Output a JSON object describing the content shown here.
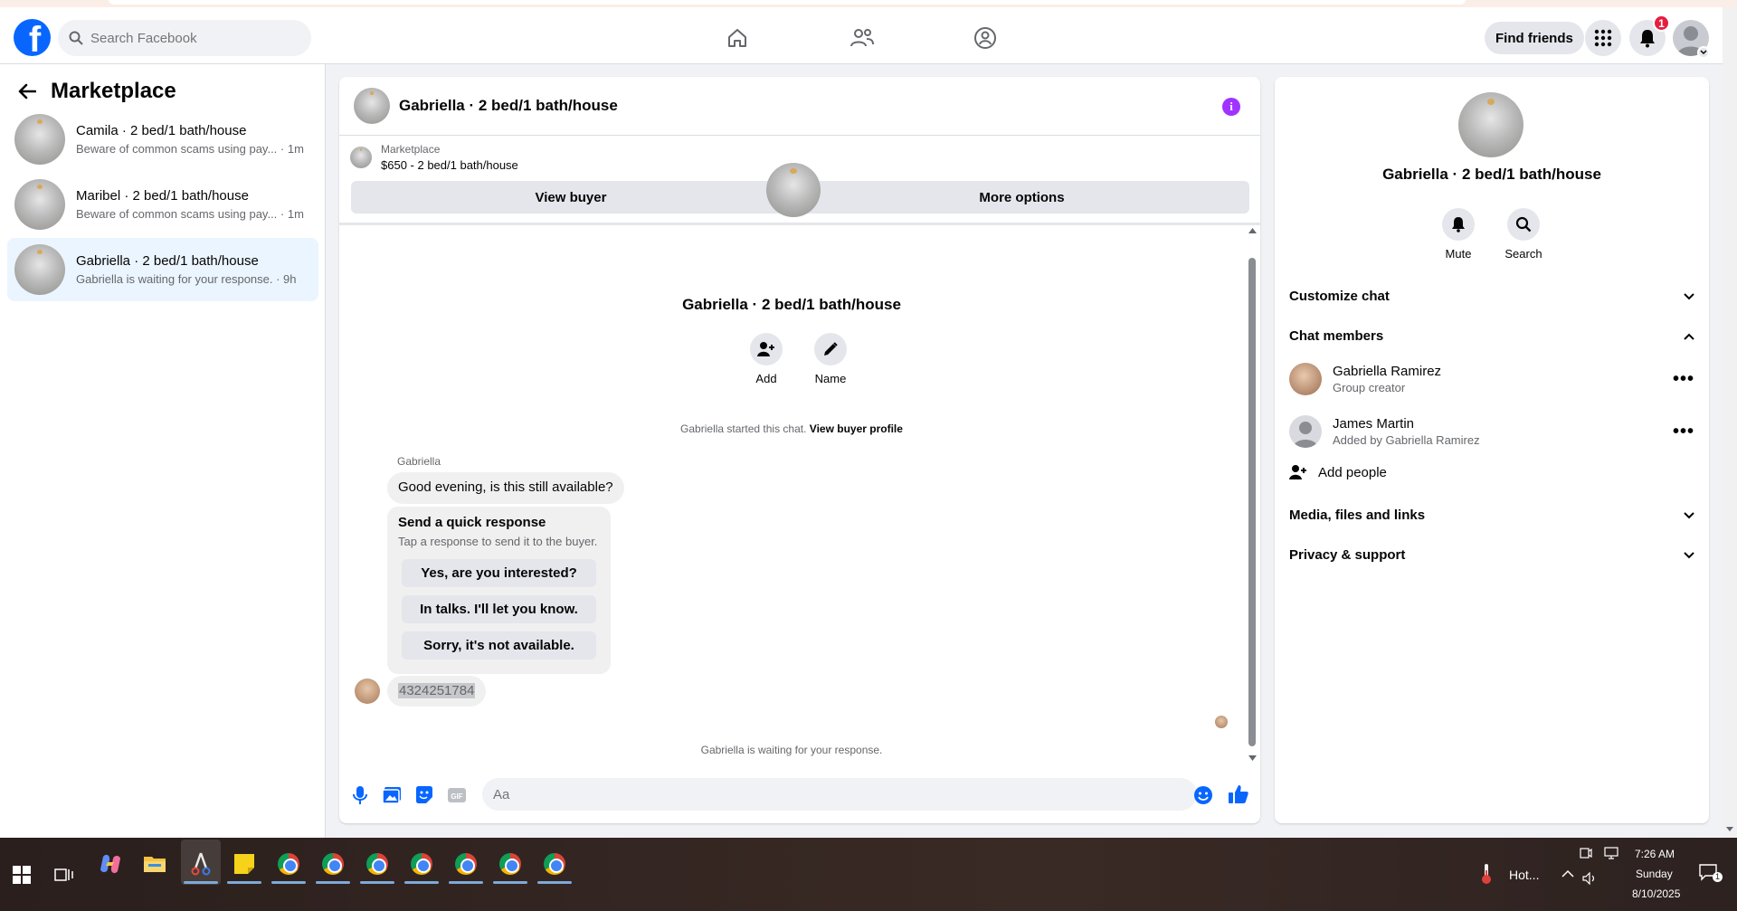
{
  "topnav": {
    "search_placeholder": "Search Facebook",
    "find_friends": "Find friends",
    "notification_count": "1"
  },
  "sidebar": {
    "title": "Marketplace",
    "conversations": [
      {
        "title": "Camila · 2 bed/1 bath/house",
        "preview": "Beware of common scams using pay... · 1m",
        "active": false
      },
      {
        "title": "Maribel · 2 bed/1 bath/house",
        "preview": "Beware of common scams using pay... · 1m",
        "active": false
      },
      {
        "title": "Gabriella · 2 bed/1 bath/house",
        "preview": "Gabriella is waiting for your response. · 9h",
        "active": true
      }
    ]
  },
  "chat": {
    "header_title": "Gabriella · 2 bed/1 bath/house",
    "listing_label": "Marketplace",
    "listing_price": "$650 - 2 bed/1 bath/house",
    "view_buyer": "View buyer",
    "more_options": "More options",
    "group_name": "Gabriella · 2 bed/1 bath/house",
    "add_label": "Add",
    "name_label": "Name",
    "started_text": "Gabriella started this chat.",
    "view_buyer_profile": "View buyer profile",
    "sender_name": "Gabriella",
    "first_message": "Good evening, is this still available?",
    "quick_title": "Send a quick response",
    "quick_subtitle": "Tap a response to send it to the buyer.",
    "quick_responses": [
      "Yes, are you interested?",
      "In talks. I'll let you know.",
      "Sorry, it's not available."
    ],
    "phone_message": "4324251784",
    "waiting_text": "Gabriella is waiting for your response.",
    "composer_placeholder": "Aa"
  },
  "details": {
    "name": "Gabriella · 2 bed/1 bath/house",
    "mute_label": "Mute",
    "search_label": "Search",
    "customize_chat": "Customize chat",
    "chat_members": "Chat members",
    "members": [
      {
        "name": "Gabriella Ramirez",
        "role": "Group creator"
      },
      {
        "name": "James Martin",
        "role": "Added by Gabriella Ramirez"
      }
    ],
    "add_people": "Add people",
    "media_files": "Media, files and links",
    "privacy_support": "Privacy & support"
  },
  "taskbar": {
    "weather": "Hot...",
    "time": "7:26 AM",
    "day": "Sunday",
    "date": "8/10/2025",
    "notification_count": "1"
  },
  "colors": {
    "brand_blue": "#0866ff",
    "active_conversation": "#ebf5ff",
    "info_purple": "#a033ff",
    "badge_red": "#e41e3f"
  }
}
